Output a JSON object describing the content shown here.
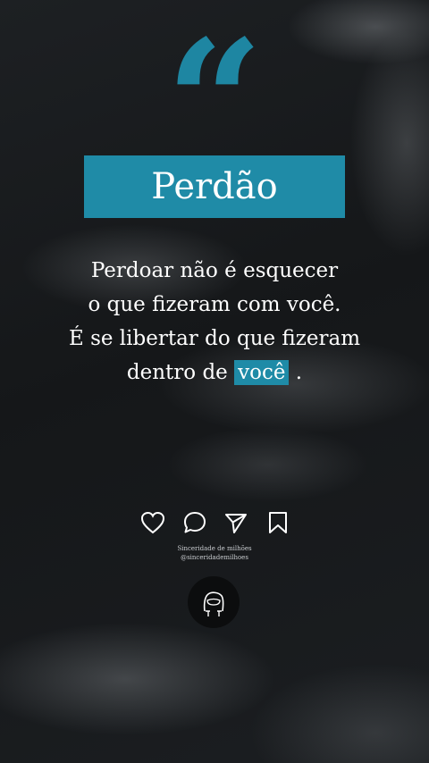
{
  "post": {
    "quote_mark": "“",
    "title": "Perdão",
    "lines": [
      "Perdoar não é esquecer",
      "o que fizeram com você.",
      "É se libertar do que fizeram",
      "dentro de"
    ],
    "highlight": "você",
    "end_punct": " ."
  },
  "actions": {
    "like": "heart-icon",
    "comment": "comment-icon",
    "share": "send-icon",
    "save": "bookmark-icon"
  },
  "account": {
    "name": "Sinceridade de milhões",
    "handle": "@sinceridademilhoes"
  },
  "colors": {
    "accent": "#1f8ba7",
    "text": "#ffffff"
  }
}
